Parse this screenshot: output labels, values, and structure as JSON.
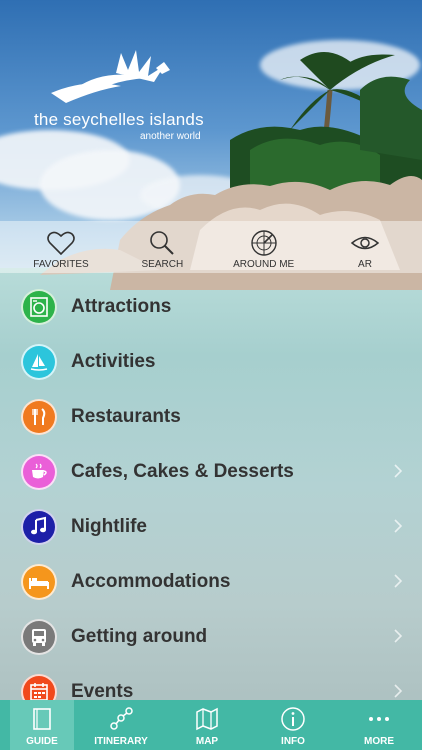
{
  "logo": {
    "title": "the seychelles islands",
    "subtitle": "another world"
  },
  "quick_actions": [
    {
      "label": "FAVORITES",
      "icon": "heart-icon"
    },
    {
      "label": "SEARCH",
      "icon": "search-icon"
    },
    {
      "label": "AROUND ME",
      "icon": "radar-icon"
    },
    {
      "label": "AR",
      "icon": "eye-icon"
    }
  ],
  "menu": [
    {
      "label": "Attractions",
      "icon": "washing-machine-icon",
      "color": "#2db34a"
    },
    {
      "label": "Activities",
      "icon": "windsurf-icon",
      "color": "#2cc5dc"
    },
    {
      "label": "Restaurants",
      "icon": "fork-knife-icon",
      "color": "#f07a1f"
    },
    {
      "label": "Cafes, Cakes & Desserts",
      "icon": "coffee-cup-icon",
      "color": "#ea5fd8"
    },
    {
      "label": "Nightlife",
      "icon": "music-note-icon",
      "color": "#1d1fa8"
    },
    {
      "label": "Accommodations",
      "icon": "bed-icon",
      "color": "#f5961c"
    },
    {
      "label": "Getting around",
      "icon": "bus-icon",
      "color": "#7a7a7a"
    },
    {
      "label": "Events",
      "icon": "calendar-icon",
      "color": "#f1491c"
    }
  ],
  "tabs": [
    {
      "label": "GUIDE",
      "icon": "book-icon",
      "active": true
    },
    {
      "label": "ITINERARY",
      "icon": "route-icon",
      "active": false
    },
    {
      "label": "MAP",
      "icon": "map-icon",
      "active": false
    },
    {
      "label": "INFO",
      "icon": "info-icon",
      "active": false
    },
    {
      "label": "MORE",
      "icon": "more-icon",
      "active": false
    }
  ],
  "colors": {
    "tabbar": "#43b8a5",
    "tab_active": "#67c9b8"
  }
}
